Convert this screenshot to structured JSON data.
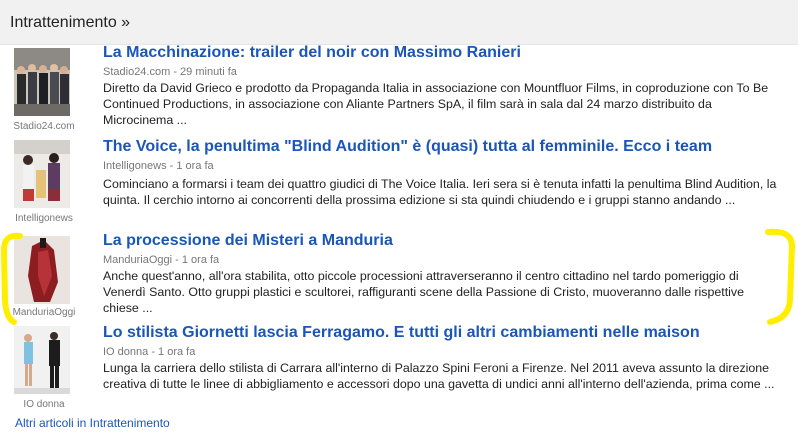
{
  "section": {
    "title": "Intrattenimento »"
  },
  "articles": [
    {
      "title": "La Macchinazione: trailer del noir con Massimo Ranieri",
      "source": "Stadio24.com",
      "time": "29 minuti fa",
      "snippet": "Diretto da David Grieco e prodotto da Propaganda Italia in associazione con Mountfluor Films, in coproduzione con To Be Continued Productions, in associazione con Aliante Partners SpA, il film sarà in sala dal 24 marzo distribuito da Microcinema ...",
      "thumb_caption": "Stadio24.com"
    },
    {
      "title": "The Voice, la penultima \"Blind Audition\" è (quasi) tutta al femminile. Ecco i team",
      "source": "Intelligonews",
      "time": "1 ora fa",
      "snippet": "Cominciano a formarsi i team dei quattro giudici di The Voice Italia. Ieri sera si è tenuta infatti la penultima Blind Audition, la quinta. Il cerchio intorno ai concorrenti della prossima edizione si sta quindi chiudendo e i gruppi stanno andando ...",
      "thumb_caption": "Intelligonews"
    },
    {
      "title": "La processione dei Misteri a Manduria",
      "source": "ManduriaOggi",
      "time": "1 ora fa",
      "snippet": "Anche quest'anno, all'ora stabilita, otto piccole processioni attraverseranno il centro cittadino nel tardo pomeriggio di Venerdì Santo. Otto gruppi plastici e scultorei, raffiguranti scene della Passione di Cristo, muoveranno dalle rispettive chiese ...",
      "thumb_caption": "ManduriaOggi"
    },
    {
      "title": "Lo stilista Giornetti lascia Ferragamo. E tutti gli altri cambiamenti nelle maison",
      "source": "IO donna",
      "time": "1 ora fa",
      "snippet": "Lunga la carriera dello stilista di Carrara all'interno di Palazzo Spini Feroni a Firenze. Nel 2011 aveva assunto la direzione creativa di tutte le linee di abbigliamento e accessori dopo una gavetta di undici anni all'interno dell'azienda, prima come ...",
      "thumb_caption": "IO donna"
    }
  ],
  "footer": {
    "more_link": "Altri articoli in Intrattenimento"
  },
  "colors": {
    "link": "#1a56b8",
    "meta": "#777777",
    "text": "#222222",
    "highlight": "#ffee00"
  }
}
